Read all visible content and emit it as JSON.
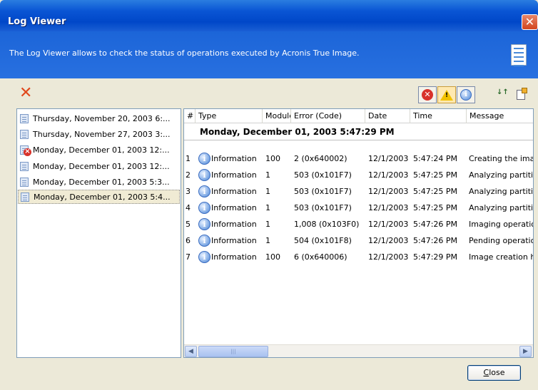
{
  "window": {
    "title": "Log Viewer",
    "close_glyph": "✕"
  },
  "banner": {
    "description": "The Log Viewer allows to check the status of operations executed by Acronis True Image.",
    "icon": "log-document-icon"
  },
  "toolbar": {
    "delete_glyph": "✕",
    "filters": [
      {
        "name": "errors",
        "icon": "error-icon",
        "glyph": "✕",
        "active": false
      },
      {
        "name": "warnings",
        "icon": "warning-icon",
        "glyph": "!",
        "active": true
      },
      {
        "name": "information",
        "icon": "info-icon",
        "glyph": "i",
        "active": false
      }
    ],
    "sort_glyph": "↓↑",
    "properties_icon": "properties-icon"
  },
  "sessions": [
    {
      "label": "Thursday, November 20, 2003 6:...",
      "icon": "log-icon",
      "error": false,
      "selected": false
    },
    {
      "label": "Thursday, November 27, 2003 3:...",
      "icon": "log-icon",
      "error": false,
      "selected": false
    },
    {
      "label": "Monday, December 01, 2003 12:...",
      "icon": "log-error-icon",
      "error": true,
      "selected": false
    },
    {
      "label": "Monday, December 01, 2003 12:...",
      "icon": "log-icon",
      "error": false,
      "selected": false
    },
    {
      "label": "Monday, December 01, 2003 5:3...",
      "icon": "log-icon",
      "error": false,
      "selected": false
    },
    {
      "label": "Monday, December 01, 2003 5:4...",
      "icon": "log-icon",
      "error": false,
      "selected": true
    }
  ],
  "table": {
    "columns": [
      "#",
      "Type",
      "Module",
      "Error (Code)",
      "Date",
      "Time",
      "Message"
    ],
    "group_title": "Monday, December 01, 2003 5:47:29 PM",
    "rows": [
      {
        "num": "1",
        "type": "Information",
        "module": "100",
        "error": "2 (0x640002)",
        "date": "12/1/2003",
        "time": "5:47:24 PM",
        "message": "Creating the imag"
      },
      {
        "num": "2",
        "type": "Information",
        "module": "1",
        "error": "503 (0x101F7)",
        "date": "12/1/2003",
        "time": "5:47:25 PM",
        "message": "Analyzing partitio"
      },
      {
        "num": "3",
        "type": "Information",
        "module": "1",
        "error": "503 (0x101F7)",
        "date": "12/1/2003",
        "time": "5:47:25 PM",
        "message": "Analyzing partitio"
      },
      {
        "num": "4",
        "type": "Information",
        "module": "1",
        "error": "503 (0x101F7)",
        "date": "12/1/2003",
        "time": "5:47:25 PM",
        "message": "Analyzing partitio"
      },
      {
        "num": "5",
        "type": "Information",
        "module": "1",
        "error": "1,008 (0x103F0)",
        "date": "12/1/2003",
        "time": "5:47:26 PM",
        "message": "Imaging operatio"
      },
      {
        "num": "6",
        "type": "Information",
        "module": "1",
        "error": "504 (0x101F8)",
        "date": "12/1/2003",
        "time": "5:47:26 PM",
        "message": "Pending operatio"
      },
      {
        "num": "7",
        "type": "Information",
        "module": "100",
        "error": "6 (0x640006)",
        "date": "12/1/2003",
        "time": "5:47:29 PM",
        "message": "Image creation ha"
      }
    ]
  },
  "scrollbar": {
    "left_arrow": "◀",
    "right_arrow": "▶",
    "grip": "|||"
  },
  "buttons": {
    "close": "Close"
  },
  "colors": {
    "title_bar": "#0a55d4",
    "banner": "#1c65d8",
    "error": "#d8322a",
    "warning": "#f2c200",
    "info": "#4a86d8"
  }
}
